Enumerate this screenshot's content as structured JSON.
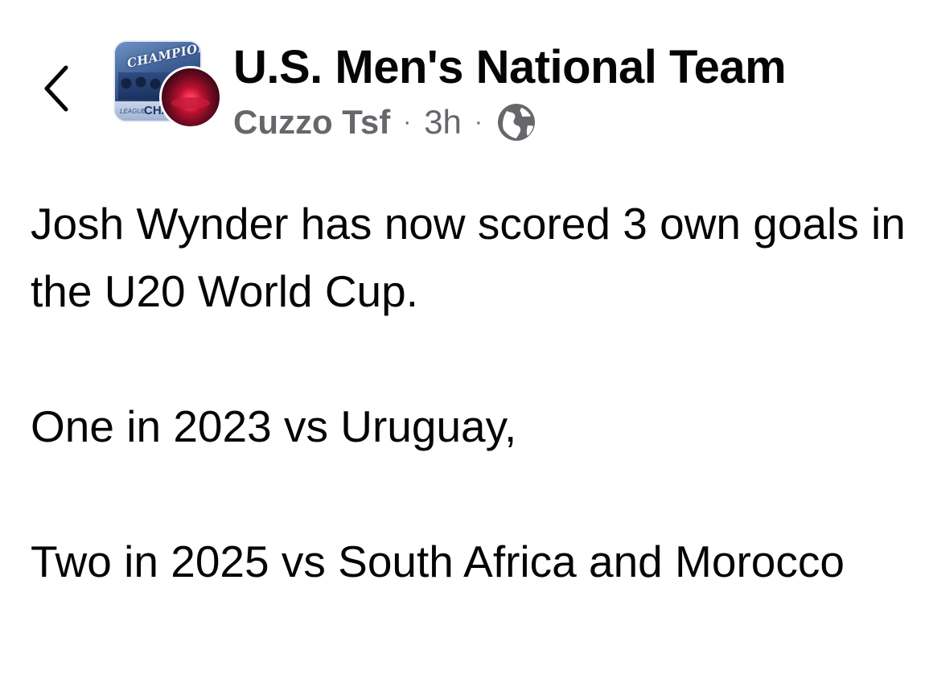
{
  "header": {
    "group_name": "U.S. Men's National Team",
    "group_avatar_text": {
      "banner": "CHAMPIONS",
      "strip": "CHA",
      "strip_small": "LEAGUE"
    },
    "author_name": "Cuzzo Tsf",
    "separator": "·",
    "time_ago": "3h",
    "back_icon": "chevron-left-icon",
    "privacy_icon": "globe-icon"
  },
  "post": {
    "paragraphs": [
      "Josh Wynder has now scored 3 own goals in the U20 World Cup.",
      "One in 2023 vs Uruguay,",
      "Two in 2025 vs South Africa and Morocco"
    ]
  },
  "colors": {
    "text_primary": "#050505",
    "text_secondary": "#65676b",
    "background": "#ffffff"
  }
}
